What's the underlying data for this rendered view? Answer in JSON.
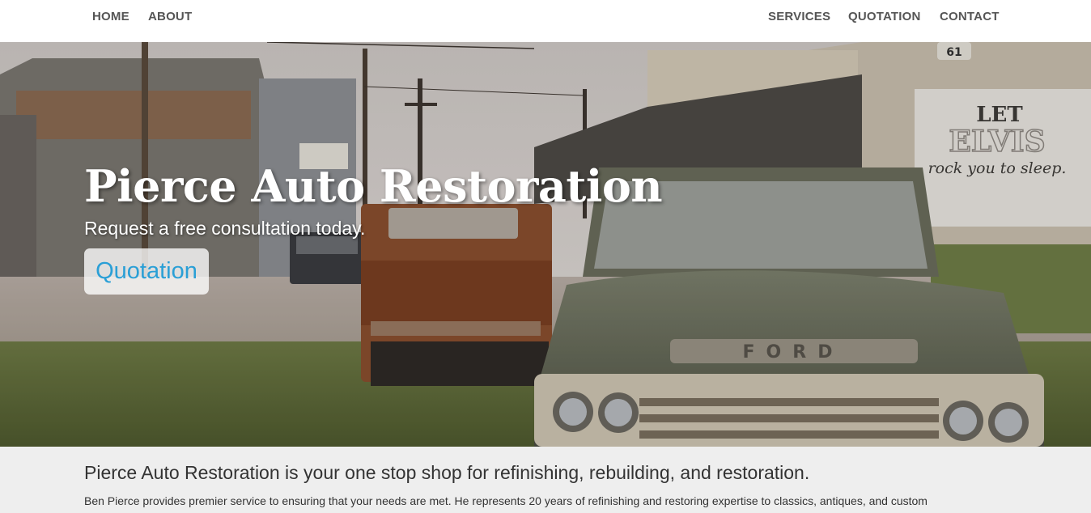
{
  "nav": {
    "left": [
      "HOME",
      "ABOUT"
    ],
    "right": [
      "SERVICES",
      "QUOTATION",
      "CONTACT"
    ]
  },
  "hero": {
    "title": "Pierce Auto Restoration",
    "subtitle": "Request a free consultation today.",
    "cta_label": "Quotation",
    "image": {
      "sign_line1": "LET",
      "sign_line2": "ELVIS",
      "sign_line3": "rock you to sleep.",
      "route_sign": "61",
      "grille_text": "FORD"
    }
  },
  "about": {
    "heading": "Pierce Auto Restoration is your one stop shop for refinishing, rebuilding, and restoration.",
    "body": "Ben Pierce provides premier service to ensuring that your needs are met. He represents 20 years of refinishing and restoring expertise to classics, antiques, and custom"
  },
  "colors": {
    "accent": "#2a9fd6",
    "nav_text": "#555555",
    "section_bg": "#eeeeee"
  }
}
